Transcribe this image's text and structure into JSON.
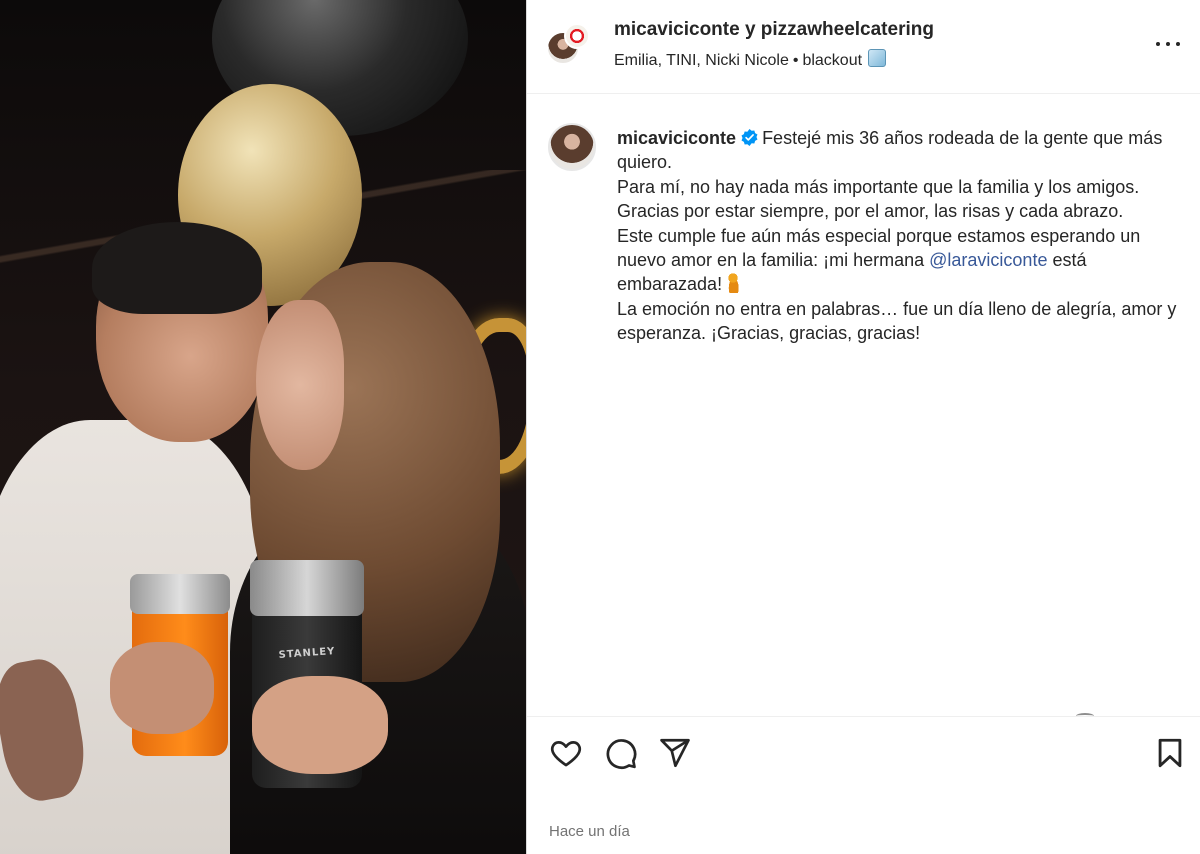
{
  "post_header": {
    "title": "micaviciconte y pizzawheelcatering",
    "audio": {
      "artists": "Emilia, TINI, Nicki Nicole",
      "separator": "•",
      "track": "blackout",
      "track_icon": "ice-cube-emoji"
    },
    "more_icon": "three-dots-icon"
  },
  "media": {
    "cup_brand": "STANLEY"
  },
  "caption": {
    "username": "micaviciconte",
    "verified_icon": "verified-badge-icon",
    "verified_color": "#0095f6",
    "lines": {
      "l1": "Festejé mis 36 años rodeada de la gente que más quiero.",
      "l2": "Para mí, no hay nada más importante que la familia y los amigos.",
      "l3": "Gracias por estar siempre, por el amor, las risas y cada abrazo.",
      "l4_before": "Este cumple fue aún más especial porque estamos esperando un nuevo amor en la familia: ¡mi hermana ",
      "l4_mention": "@laraviciconte",
      "l4_after": " está embarazada!",
      "l4_emoji": "pregnant-woman-emoji",
      "l5": "La emoción no entra en palabras… fue un día lleno de alegría, amor y esperanza. ¡Gracias, gracias, gracias!"
    },
    "mention_color": "#385898"
  },
  "actions": {
    "like_icon": "heart-icon",
    "comment_icon": "comment-bubble-icon",
    "share_icon": "paper-plane-icon",
    "save_icon": "bookmark-icon"
  },
  "timestamp": "Hace un día"
}
